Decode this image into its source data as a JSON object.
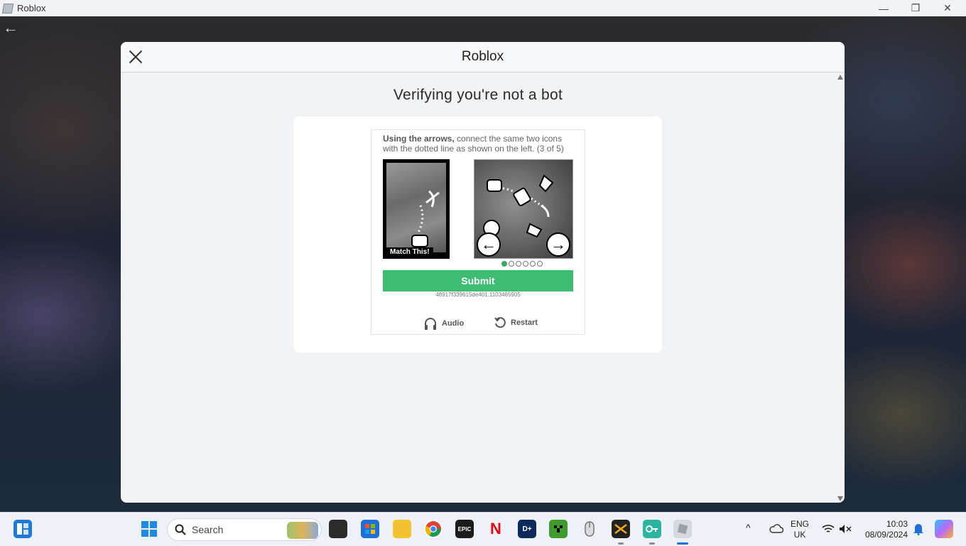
{
  "window": {
    "title": "Roblox",
    "controls": {
      "minimize": "—",
      "maximize": "❐",
      "close": "✕"
    }
  },
  "modal": {
    "title": "Roblox",
    "heading": "Verifying you're not a bot"
  },
  "captcha": {
    "instruction_bold": "Using the arrows,",
    "instruction_rest": " connect the same two icons with the dotted line as shown on the left. (3 of 5)",
    "match_label": "Match This!",
    "prev_symbol": "←",
    "next_symbol": "→",
    "option_count": 6,
    "selected_option": 1,
    "submit_label": "Submit",
    "token": "48917f339615de401.1103465905",
    "audio_label": "Audio",
    "restart_label": "Restart"
  },
  "taskbar": {
    "search_placeholder": "Search",
    "icons": [
      "widgets-icon",
      "start-icon",
      "task-view-icon",
      "microsoft-store-icon",
      "file-explorer-icon",
      "chrome-icon",
      "epic-games-icon",
      "netflix-icon",
      "disney-plus-icon",
      "minecraft-icon",
      "mouse-app-icon",
      "app-icon",
      "vpn-icon",
      "roblox-icon"
    ],
    "epic_label": "EPIC",
    "netflix_label": "N",
    "disney_label": "D+",
    "language": "ENG",
    "region": "UK",
    "time": "10:03",
    "date": "08/09/2024"
  },
  "colors": {
    "submit": "#3dbc72",
    "active_dot": "#3fa56b",
    "taskbar_accent": "#1f6fd6"
  }
}
